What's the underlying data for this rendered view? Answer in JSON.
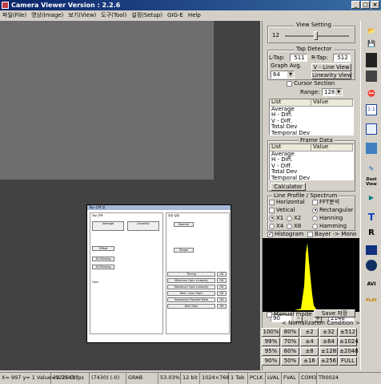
{
  "window": {
    "title": "Camera Viewer Version : 2.2.6",
    "min": "_",
    "max": "□",
    "close": "×"
  },
  "menu": [
    "파일(File)",
    "영상(Image)",
    "보기(View)",
    "도구(Tool)",
    "설정(Setup)",
    "GIG-E",
    "Help"
  ],
  "view_setting": {
    "title": "View Setting",
    "value": "12",
    "slider_level": 0.45
  },
  "tap_detector": {
    "title": "Tap Detector",
    "ltap_label": "L-Tap:",
    "ltap_value": "511",
    "rtap_label": "R-Tap:",
    "rtap_value": "512",
    "graph_avg_label": "Graph Avg.",
    "graph_avg_value": "64",
    "vline_button": "V - Line View",
    "linearity_button": "Linearity View",
    "cursor_section_label": "Cursor Section",
    "range_label": "Range:",
    "range_value": "128"
  },
  "cursor_list": {
    "headers": [
      "List",
      "Value"
    ],
    "items": [
      "Average",
      "H - Diff.",
      "V - Diff.",
      "Total Dev",
      "Temporal Dev"
    ]
  },
  "frame_data": {
    "title": "Frame Data",
    "headers": [
      "List",
      "Value"
    ],
    "items": [
      "Average",
      "H - Diff.",
      "V - Diff.",
      "Total Dev",
      "Temporal Dev"
    ],
    "calc_button": "Calculator"
  },
  "line_profile": {
    "title": "Line Profile / Spectrum",
    "horizontal": "Horizontal",
    "vertical": "Vetical",
    "fft": "FFT분석",
    "rectangular": "Rectangular",
    "hanning": "Hanning",
    "hamming": "Hamming",
    "x1": "X1",
    "x2": "X2",
    "x4": "X4",
    "x8": "X8",
    "histogram": "Histogram",
    "bayer": "Bayer -> Mono"
  },
  "histogram_range": {
    "min": "90",
    "max": "2146",
    "minus": "-",
    "plus": "+"
  },
  "manual": {
    "label": "Manual mode",
    "save_button": "Save 저장"
  },
  "normalization": {
    "title": "< Nomalization Condition >",
    "buttons": [
      [
        "100%",
        "80%",
        "±2",
        "±32",
        "±512"
      ],
      [
        "99%",
        "70%",
        "±4",
        "±64",
        "±1024"
      ],
      [
        "95%",
        "60%",
        "±8",
        "±128",
        "±2048"
      ],
      [
        "90%",
        "50%",
        "±16",
        "±256",
        "FULL"
      ]
    ]
  },
  "toolbar": {
    "items": [
      "open-icon",
      "save-icon",
      "record-icon",
      "film-icon",
      "fps-icon",
      "scale-icon",
      "fit-icon",
      "fullscreen-icon",
      "export-icon",
      "dust-view-icon",
      "play-icon",
      "text-icon",
      "reset-icon",
      "monitor-icon",
      "camera-icon",
      "avi-icon"
    ],
    "text_labels": {
      "dust": "Dust\nView",
      "t": "T",
      "r": "R",
      "avi": "AVI",
      "play": "PLAY",
      "fit": "1:1"
    }
  },
  "status": [
    "X=  997  y=    1   Value=1226 (9)",
    "29.7143 fps",
    "(7430) (-0)",
    "GRAB",
    "53.03%",
    "12 bit",
    "1024×768",
    "1 Tab",
    "PCLK",
    "LVAL",
    "FVAL",
    "COM3",
    "TR0024"
  ],
  "dialog": {
    "title": "Tap 선택 창",
    "left_header": "Tap 선택",
    "right_header": "영상 설정",
    "labels": [
      "Average",
      "Linearity",
      "Offset",
      "X2 Binning",
      "X4 Binning",
      "Gain",
      "Normal",
      "Single",
      "Timing",
      "Minimum Gain Linearity",
      "Maximum Gain Linearity",
      "Rect. Line Chart",
      "Horizontal Transfer Rate",
      "ADC Gain"
    ],
    "ok": "OK"
  }
}
